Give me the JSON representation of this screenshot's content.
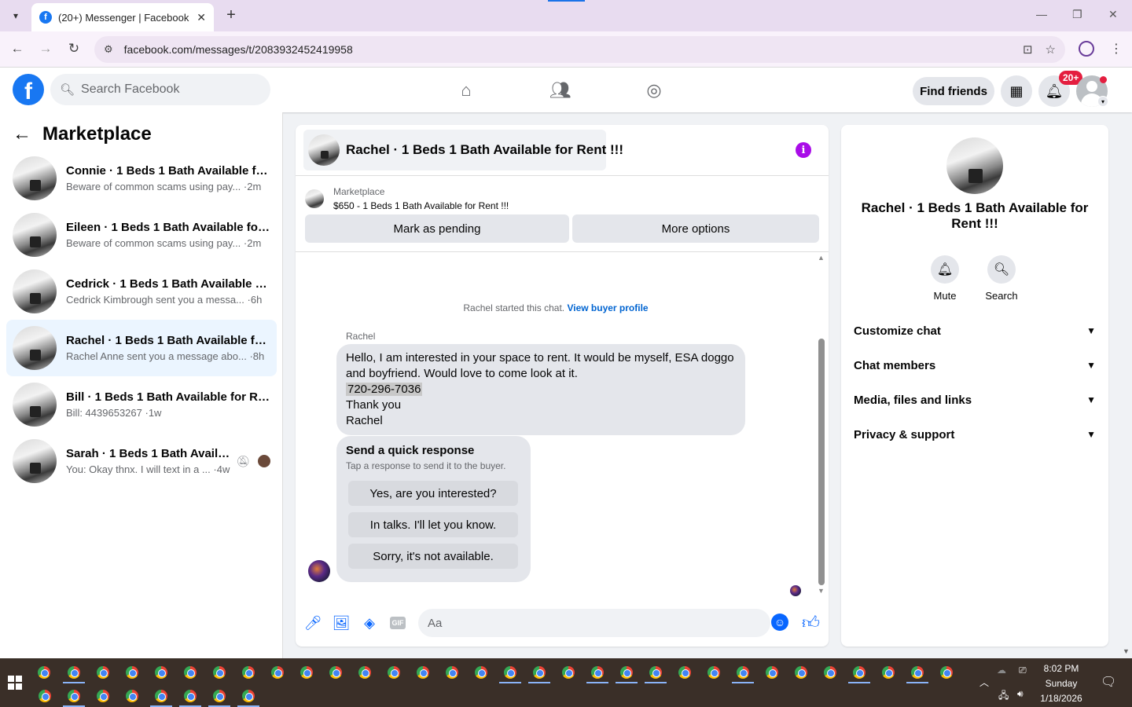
{
  "browser": {
    "tab_title": "(20+) Messenger | Facebook",
    "tab_favicon": "f",
    "url": "facebook.com/messages/t/2083932452419958"
  },
  "fb_header": {
    "search_placeholder": "Search Facebook",
    "find_friends_label": "Find friends",
    "notification_badge": "20+"
  },
  "sidebar": {
    "title": "Marketplace",
    "conversations": [
      {
        "name": "Connie · 1 Beds 1 Bath Available fo...",
        "preview": "Beware of common scams using pay...",
        "time": "·2m"
      },
      {
        "name": "Eileen · 1 Beds 1 Bath Available for ...",
        "preview": "Beware of common scams using pay...",
        "time": "·2m"
      },
      {
        "name": "Cedrick · 1 Beds 1 Bath Available fo...",
        "preview": "Cedrick Kimbrough sent you a messa...",
        "time": "·6h"
      },
      {
        "name": "Rachel · 1 Beds 1 Bath Available for...",
        "preview": "Rachel Anne sent you a message abo...",
        "time": "·8h"
      },
      {
        "name": "Bill · 1 Beds 1 Bath Available for Re...",
        "preview": "Bill: 4439653267",
        "time": "·1w"
      },
      {
        "name": "Sarah · 1 Beds 1 Bath Availab...",
        "preview": "You: Okay thnx. I will text in a ...",
        "time": "·4w"
      }
    ]
  },
  "chat": {
    "title": "Rachel · 1 Beds 1 Bath Available for Rent !!!",
    "listing_source": "Marketplace",
    "listing_title": "$650 - 1 Beds 1 Bath Available for Rent !!!",
    "mark_pending_label": "Mark as pending",
    "more_options_label": "More options",
    "system_message": "Rachel started this chat.",
    "view_buyer_profile": "View buyer profile",
    "sender_name": "Rachel",
    "message_line1": "Hello, I am interested in your space to rent. It would be myself, ESA doggo and boyfriend. Would love to come look at it.",
    "message_phone": "720-296-7036",
    "message_line3": "Thank you",
    "message_line4": "Rachel",
    "quick_title": "Send a quick response",
    "quick_sub": "Tap a response to send it to the buyer.",
    "quick_responses": [
      "Yes, are you interested?",
      "In talks. I'll let you know.",
      "Sorry, it's not available."
    ],
    "input_placeholder": "Aa",
    "gif_label": "GIF"
  },
  "right_panel": {
    "name": "Rachel · 1 Beds 1 Bath Available for Rent !!!",
    "mute_label": "Mute",
    "search_label": "Search",
    "sections": [
      "Customize chat",
      "Chat members",
      "Media, files and links",
      "Privacy & support"
    ]
  },
  "taskbar": {
    "time": "8:02 PM",
    "day": "Sunday",
    "date": "1/18/2026"
  },
  "colors": {
    "fb_blue": "#1877f2",
    "messenger_blue": "#0866ff",
    "active_conv": "#ebf5ff",
    "info_purple": "#a90ce8",
    "badge_red": "#e41e3f"
  }
}
